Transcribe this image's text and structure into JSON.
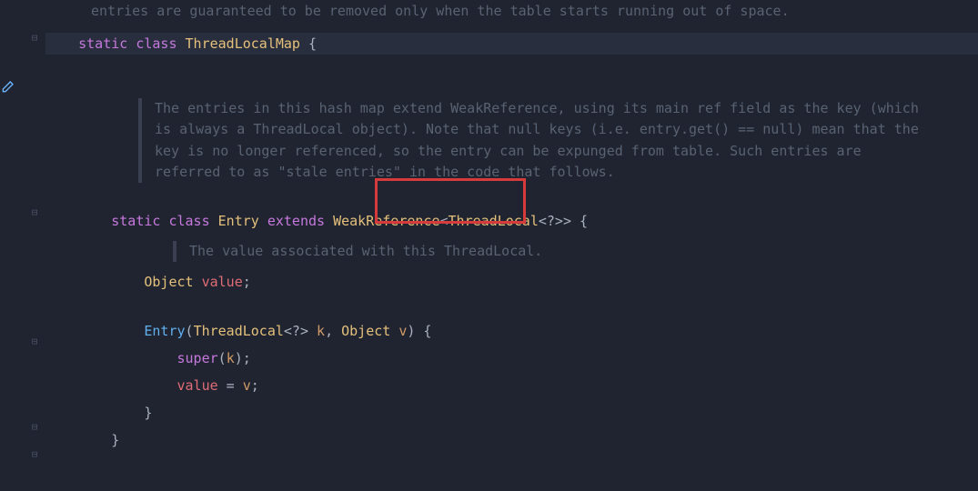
{
  "topComment": "entries are guaranteed to be removed only when the table starts running out of space.",
  "line1": {
    "kw_static": "static",
    "kw_class": "class",
    "type": "ThreadLocalMap",
    "brace": " {"
  },
  "comment1": "The entries in this hash map extend WeakReference, using its main ref field as the key (which is always a ThreadLocal object). Note that null keys (i.e. entry.get() == null) mean that the key is no longer referenced, so the entry can be expunged from table. Such entries are referred to as \"stale entries\" in the code that follows.",
  "line2": {
    "kw_static": "static",
    "kw_class": "class",
    "type_entry": "Entry",
    "kw_extends": "extends",
    "type_weak": "WeakReference",
    "lt": "<",
    "type_tl": "ThreadLocal",
    "wild": "<?>",
    "gt": ">",
    "brace": " {"
  },
  "comment2": "The value associated with this ThreadLocal.",
  "line3": {
    "type_obj": "Object",
    "ident_val": "value",
    "semi": ";"
  },
  "line4": {
    "fn": "Entry",
    "lp": "(",
    "type_tl": "ThreadLocal",
    "wild": "<?>",
    "param_k": " k",
    "comma": ", ",
    "type_obj": "Object",
    "param_v": " v",
    "rp": ")",
    "brace": " {"
  },
  "line5": {
    "kw_super": "super",
    "lp": "(",
    "param_k": "k",
    "rp": ")",
    "semi": ";"
  },
  "line6": {
    "ident_val": "value",
    "eq": " = ",
    "param_v": "v",
    "semi": ";"
  },
  "line7": {
    "brace": "}"
  },
  "line8": {
    "brace": "}"
  }
}
